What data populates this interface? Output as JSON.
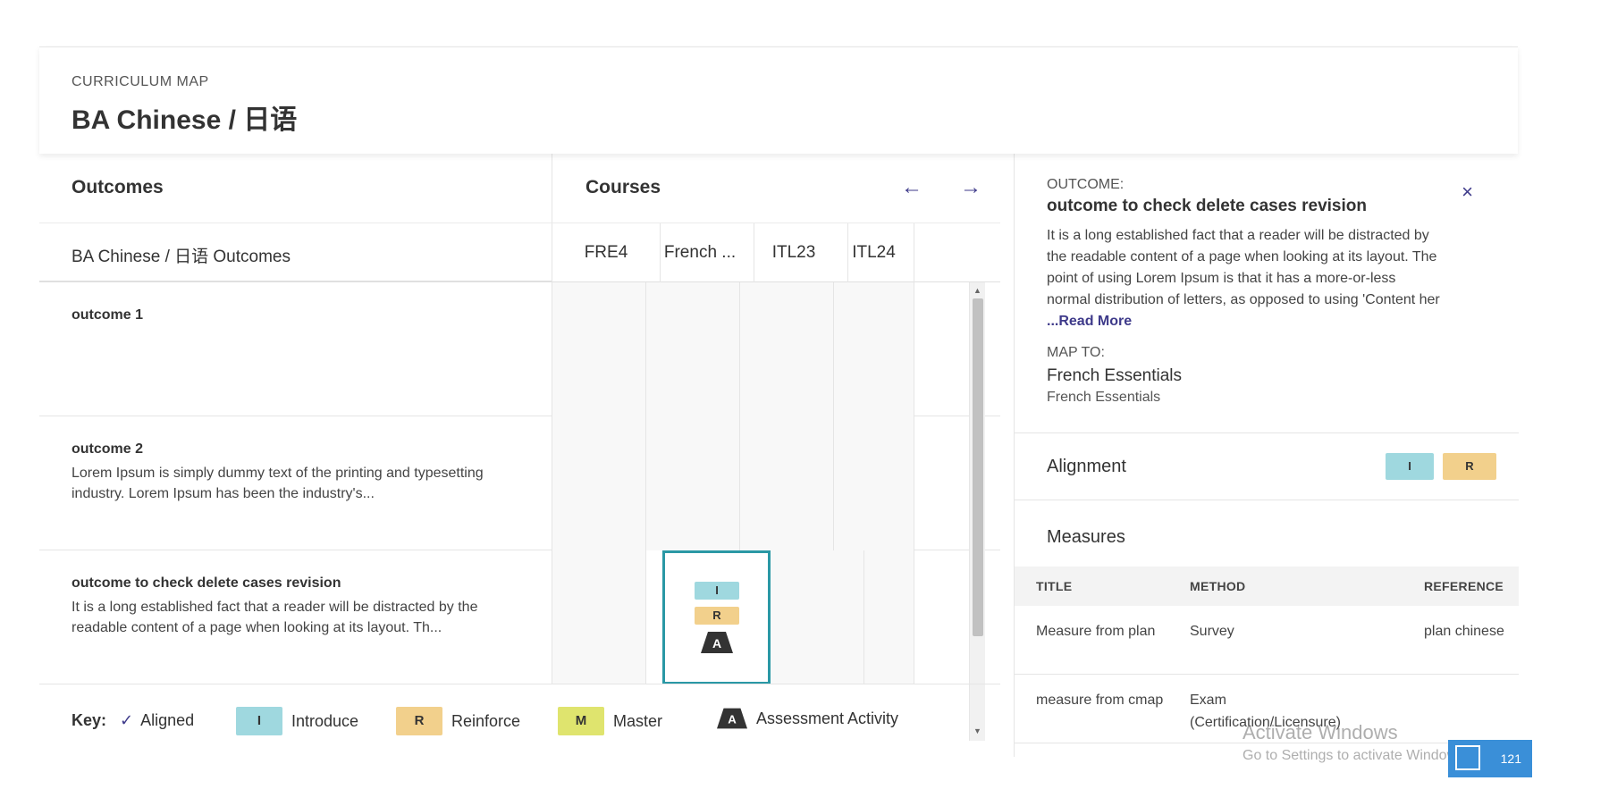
{
  "header": {
    "eyebrow": "CURRICULUM MAP",
    "title": "BA Chinese / 日语"
  },
  "map": {
    "outcomes_heading": "Outcomes",
    "courses_heading": "Courses",
    "program_row": "BA Chinese / 日语 Outcomes",
    "courses": [
      "FRE4",
      "French ...",
      "ITL23",
      "ITL24"
    ],
    "outcomes": [
      {
        "name": "outcome 1",
        "desc": ""
      },
      {
        "name": "outcome 2",
        "desc": "Lorem Ipsum is simply dummy text of the printing and typesetting industry. Lorem Ipsum has been the industry's..."
      },
      {
        "name": "outcome to check delete cases revision",
        "desc": "It is a long established fact that a reader will be distracted by the readable content of a page when looking at its layout. Th..."
      }
    ],
    "selected_cell_badges": [
      "I",
      "R",
      "A"
    ]
  },
  "key": {
    "label": "Key:",
    "aligned": "Aligned",
    "introduce_badge": "I",
    "introduce": "Introduce",
    "reinforce_badge": "R",
    "reinforce": "Reinforce",
    "master_badge": "M",
    "master": "Master",
    "assessment_badge": "A",
    "assessment": "Assessment Activity",
    "colors": {
      "introduce": "#9fd8df",
      "reinforce": "#f2d08c",
      "master": "#dfe46e",
      "assessment": "#333333"
    }
  },
  "panel": {
    "outcome_label": "OUTCOME:",
    "outcome_title": "outcome to check delete cases revision",
    "outcome_desc": "It is a long established fact that a reader will be distracted by the readable content of a page when looking at its layout. The point of using Lorem Ipsum is that it has a more-or-less normal distribution of letters, as opposed to using 'Content her ",
    "read_more": "...Read More",
    "map_to_label": "MAP TO:",
    "map_to_course": "French Essentials",
    "map_to_sub": "French Essentials",
    "alignment_label": "Alignment",
    "alignment_badges": [
      "I",
      "R"
    ],
    "measures_label": "Measures",
    "measures_headers": [
      "TITLE",
      "METHOD",
      "REFERENCE"
    ],
    "measures": [
      {
        "title": "Measure from plan",
        "method": "Survey",
        "reference": "plan chinese"
      },
      {
        "title": "measure from cmap",
        "method": "Exam (Certification/Licensure)",
        "reference": ""
      }
    ]
  },
  "overlay": {
    "activate_title": "Activate Windows",
    "activate_sub": "Go to Settings to activate Windows.",
    "chip_count": "121"
  }
}
